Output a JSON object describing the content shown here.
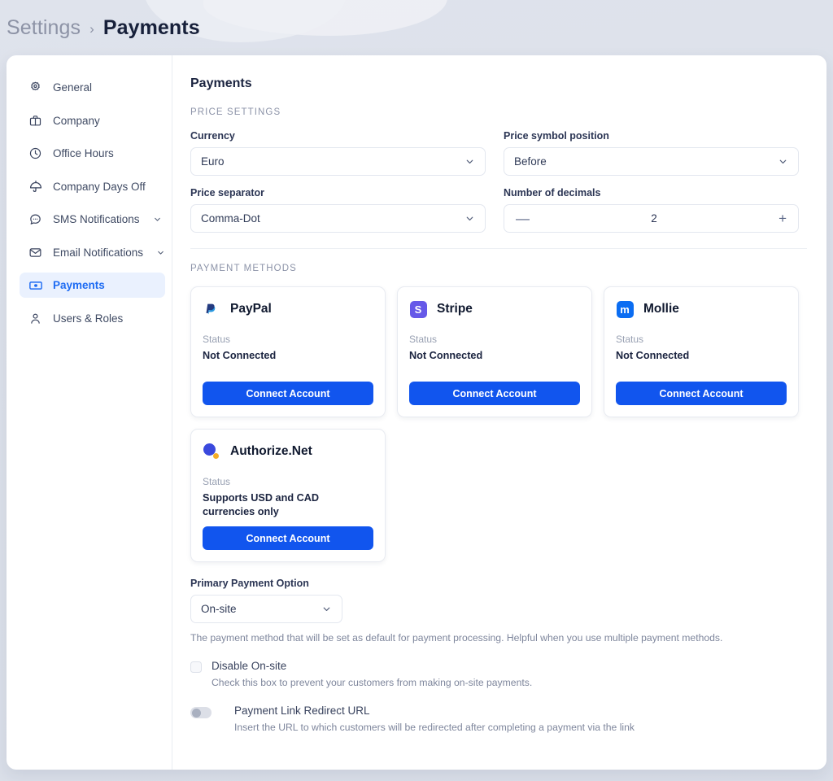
{
  "breadcrumb": {
    "root": "Settings",
    "separator": "›",
    "current": "Payments"
  },
  "sidebar": {
    "items": [
      {
        "label": "General",
        "icon": "gear-icon",
        "active": false,
        "expandable": false
      },
      {
        "label": "Company",
        "icon": "briefcase-icon",
        "active": false,
        "expandable": false
      },
      {
        "label": "Office Hours",
        "icon": "clock-icon",
        "active": false,
        "expandable": false
      },
      {
        "label": "Company Days Off",
        "icon": "umbrella-icon",
        "active": false,
        "expandable": false
      },
      {
        "label": "SMS Notifications",
        "icon": "chat-bubble-icon",
        "active": false,
        "expandable": true
      },
      {
        "label": "Email Notifications",
        "icon": "envelope-icon",
        "active": false,
        "expandable": true
      },
      {
        "label": "Payments",
        "icon": "banknote-icon",
        "active": true,
        "expandable": false
      },
      {
        "label": "Users & Roles",
        "icon": "user-icon",
        "active": false,
        "expandable": false
      }
    ]
  },
  "main": {
    "title": "Payments",
    "price_settings": {
      "heading": "PRICE SETTINGS",
      "currency": {
        "label": "Currency",
        "value": "Euro"
      },
      "price_symbol_position": {
        "label": "Price symbol position",
        "value": "Before"
      },
      "price_separator": {
        "label": "Price separator",
        "value": "Comma-Dot"
      },
      "number_of_decimals": {
        "label": "Number of decimals",
        "value": "2",
        "decrement": "—",
        "increment": "+"
      }
    },
    "payment_methods": {
      "heading": "PAYMENT METHODS",
      "status_label": "Status",
      "button_label": "Connect Account",
      "cards": [
        {
          "name": "PayPal",
          "logo": "paypal-logo",
          "status": "Not Connected"
        },
        {
          "name": "Stripe",
          "logo": "stripe-logo",
          "status": "Not Connected"
        },
        {
          "name": "Mollie",
          "logo": "mollie-logo",
          "status": "Not Connected"
        },
        {
          "name": "Authorize.Net",
          "logo": "authorize-net-logo",
          "status": "Supports USD and CAD currencies only"
        }
      ]
    },
    "primary_payment": {
      "label": "Primary Payment Option",
      "value": "On-site",
      "hint": "The payment method that will be set as default for payment processing. Helpful when you use multiple payment methods."
    },
    "disable_onsite": {
      "title": "Disable On-site",
      "description": "Check this box to prevent your customers from making on-site payments.",
      "checked": false
    },
    "payment_link_redirect": {
      "title": "Payment Link Redirect URL",
      "description": "Insert the URL to which customers will be redirected after completing a payment via the link",
      "enabled": false
    }
  },
  "colors": {
    "accent_blue": "#1155ee",
    "active_nav_bg": "#eaf1fe",
    "active_nav_text": "#1d6bf3",
    "page_bg": "#dce1ea",
    "stripe_purple": "#6659e8",
    "mollie_blue": "#0b6df2",
    "authorize_blue": "#3a49dd",
    "authorize_orange": "#f5ad28",
    "paypal_dark": "#243b80",
    "paypal_light": "#2a9ae1"
  }
}
